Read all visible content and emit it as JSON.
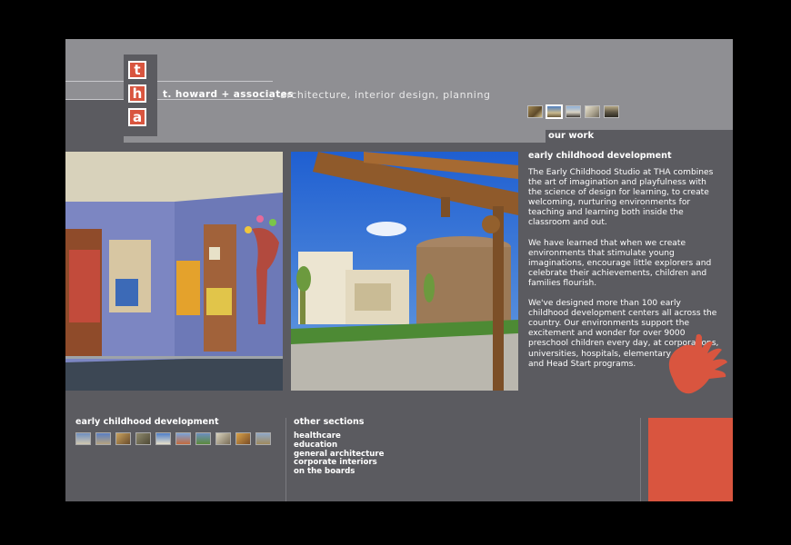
{
  "header": {
    "logo_letters": [
      "t",
      "h",
      "a"
    ],
    "firm_name": "t. howard + associates",
    "tagline": "architecture, interior design, planning",
    "section_tab": "our work"
  },
  "top_thumbnails": [
    {
      "name": "project-thumb-1",
      "selected": false
    },
    {
      "name": "project-thumb-2",
      "selected": true
    },
    {
      "name": "project-thumb-3",
      "selected": false
    },
    {
      "name": "project-thumb-4",
      "selected": false
    },
    {
      "name": "project-thumb-5",
      "selected": false
    }
  ],
  "content": {
    "title": "early childhood development",
    "paragraphs": [
      "The Early Childhood Studio at THA combines the art of imagination and playfulness with the science of design for learning, to create welcoming, nurturing environments for teaching and learning both inside the classroom and out.",
      "We have learned that when we create environments that stimulate young imaginations, encourage little explorers and celebrate their achievements, children and families flourish.",
      "We've designed more than 100 early childhood development centers all across the country. Our environments support the excitement and wonder for over 9000 preschool children every day, at corporations, universities, hospitals, elementary schools and Head Start programs."
    ]
  },
  "footer": {
    "section_title": "early childhood development",
    "thumbnail_count": 10,
    "other_title": "other sections",
    "other_links": [
      "healthcare",
      "education",
      "general architecture",
      "corporate interiors",
      "on the boards"
    ]
  },
  "colors": {
    "background": "#000000",
    "panel": "#8f8f93",
    "dark_panel": "#5b5b60",
    "accent": "#d9553f"
  }
}
